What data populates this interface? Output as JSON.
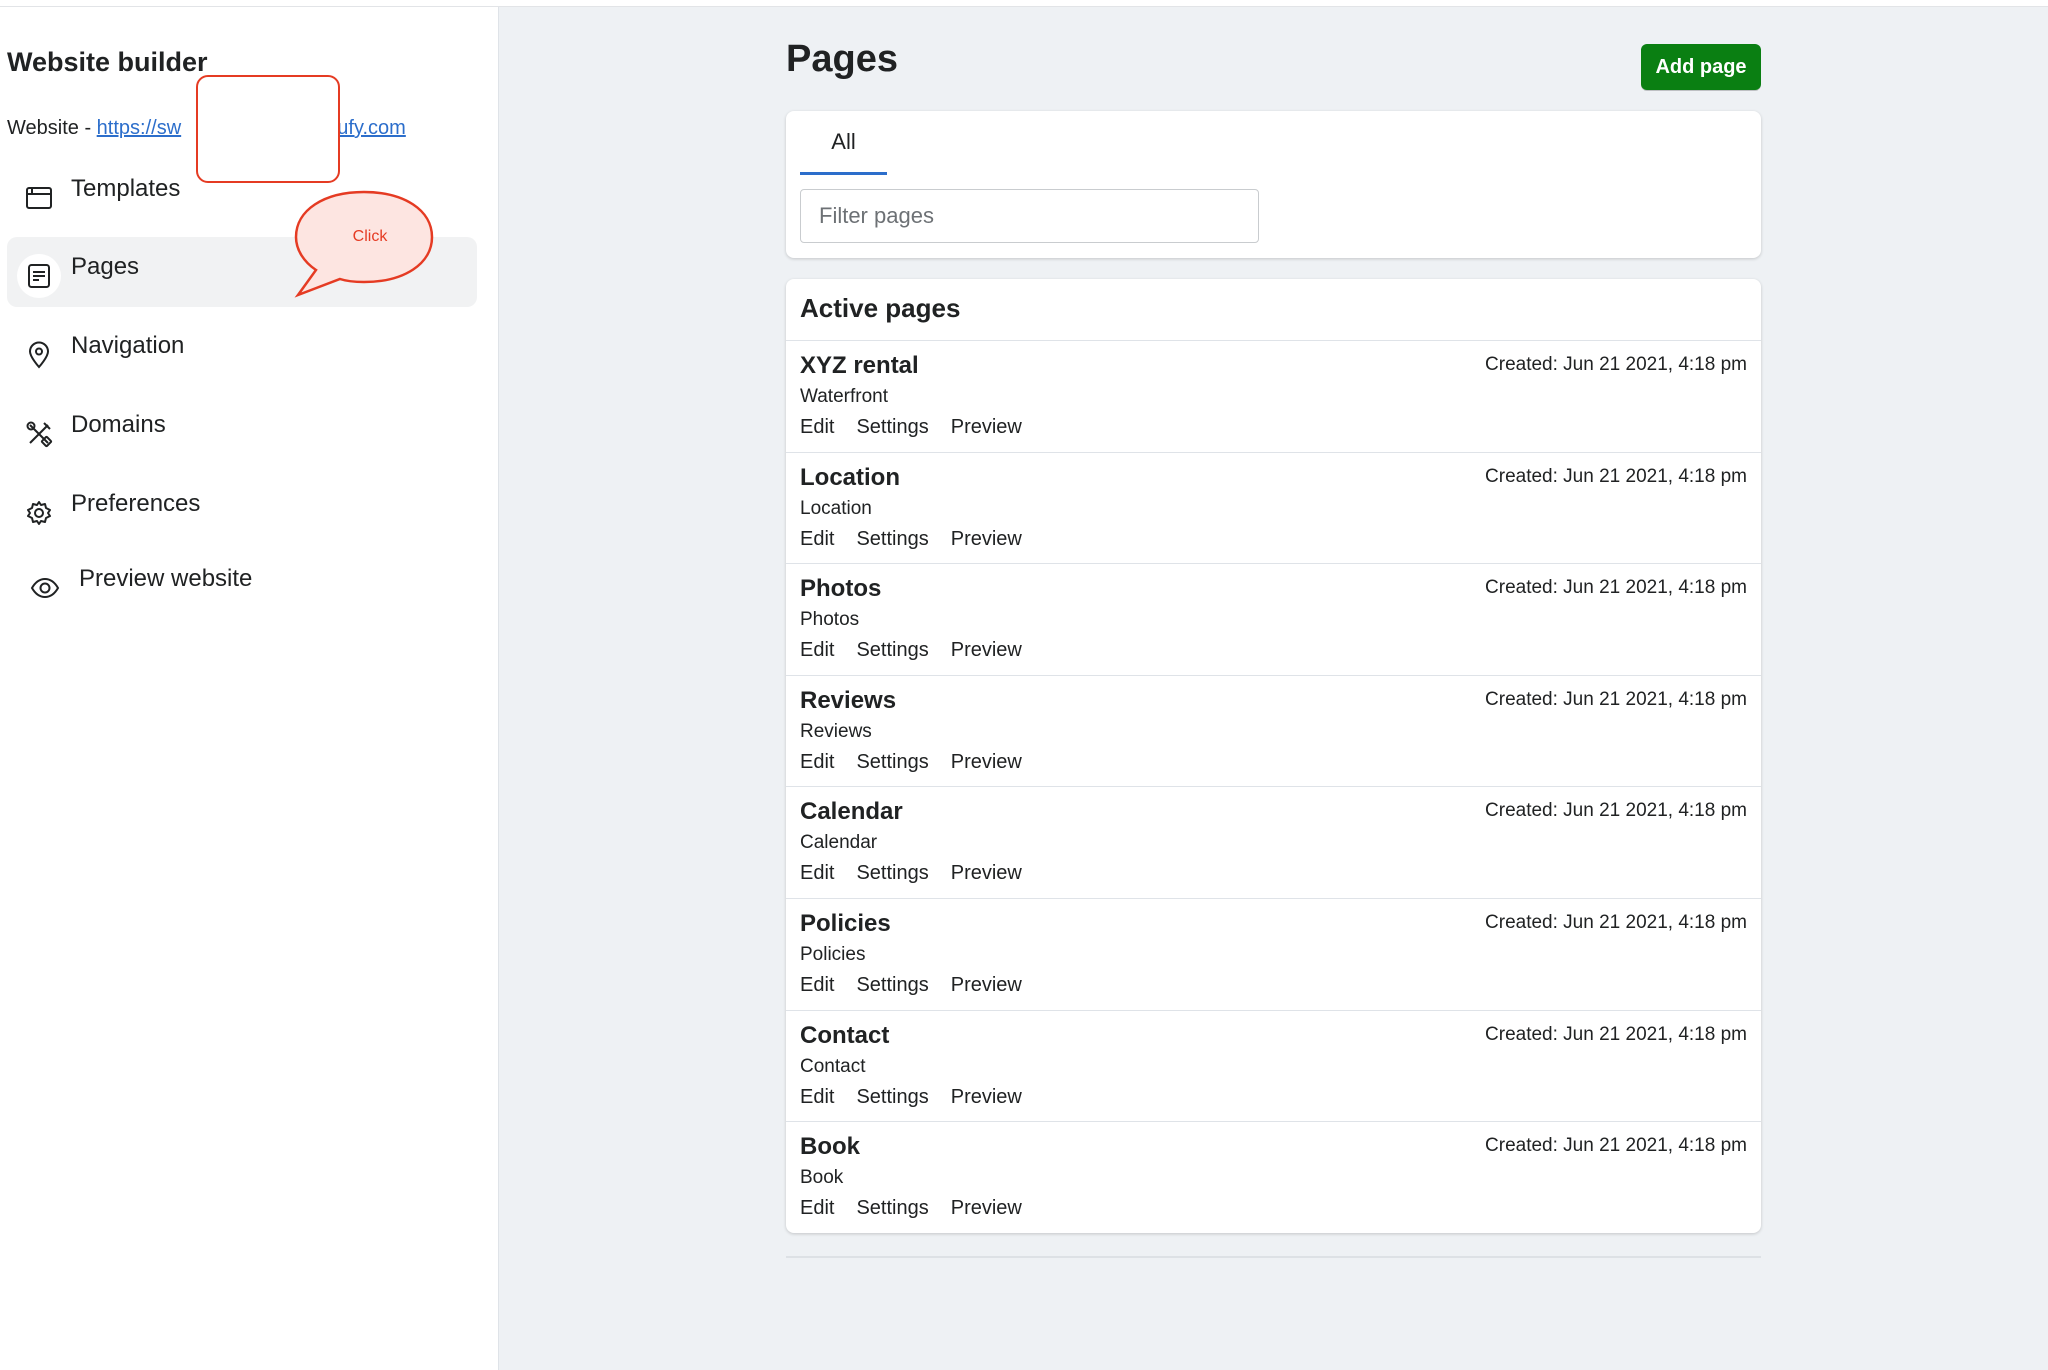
{
  "sidebar": {
    "title": "Website builder",
    "site_prefix": "Website - ",
    "site_link_start": "https://sw",
    "site_link_end": "oufy.com",
    "items": [
      {
        "label": "Templates",
        "icon": "browser-window-icon"
      },
      {
        "label": "Pages",
        "icon": "document-icon"
      },
      {
        "label": "Navigation",
        "icon": "location-pin-icon"
      },
      {
        "label": "Domains",
        "icon": "tools-icon"
      },
      {
        "label": "Preferences",
        "icon": "gear-icon"
      },
      {
        "label": "Preview website",
        "icon": "eye-icon"
      }
    ]
  },
  "annotation": {
    "bubble_text": "Click",
    "color": "#e53b23"
  },
  "main": {
    "title": "Pages",
    "add_button": "Add page",
    "tabs": [
      {
        "label": "All"
      }
    ],
    "filter_placeholder": "Filter pages",
    "section_title": "Active pages",
    "actions": {
      "edit": "Edit",
      "settings": "Settings",
      "preview": "Preview"
    },
    "pages": [
      {
        "title": "XYZ rental",
        "subtitle": "Waterfront",
        "created": "Created: Jun 21 2021, 4:18 pm"
      },
      {
        "title": "Location",
        "subtitle": "Location",
        "created": "Created: Jun 21 2021, 4:18 pm"
      },
      {
        "title": "Photos",
        "subtitle": "Photos",
        "created": "Created: Jun 21 2021, 4:18 pm"
      },
      {
        "title": "Reviews",
        "subtitle": "Reviews",
        "created": "Created: Jun 21 2021, 4:18 pm"
      },
      {
        "title": "Calendar",
        "subtitle": "Calendar",
        "created": "Created: Jun 21 2021, 4:18 pm"
      },
      {
        "title": "Policies",
        "subtitle": "Policies",
        "created": "Created: Jun 21 2021, 4:18 pm"
      },
      {
        "title": "Contact",
        "subtitle": "Contact",
        "created": "Created: Jun 21 2021, 4:18 pm"
      },
      {
        "title": "Book",
        "subtitle": "Book",
        "created": "Created: Jun 21 2021, 4:18 pm"
      }
    ]
  },
  "colors": {
    "primary_button": "#0a7f12",
    "link": "#2c6ecb",
    "tab_underline": "#2c6ecb",
    "annotation": "#e53b23"
  }
}
